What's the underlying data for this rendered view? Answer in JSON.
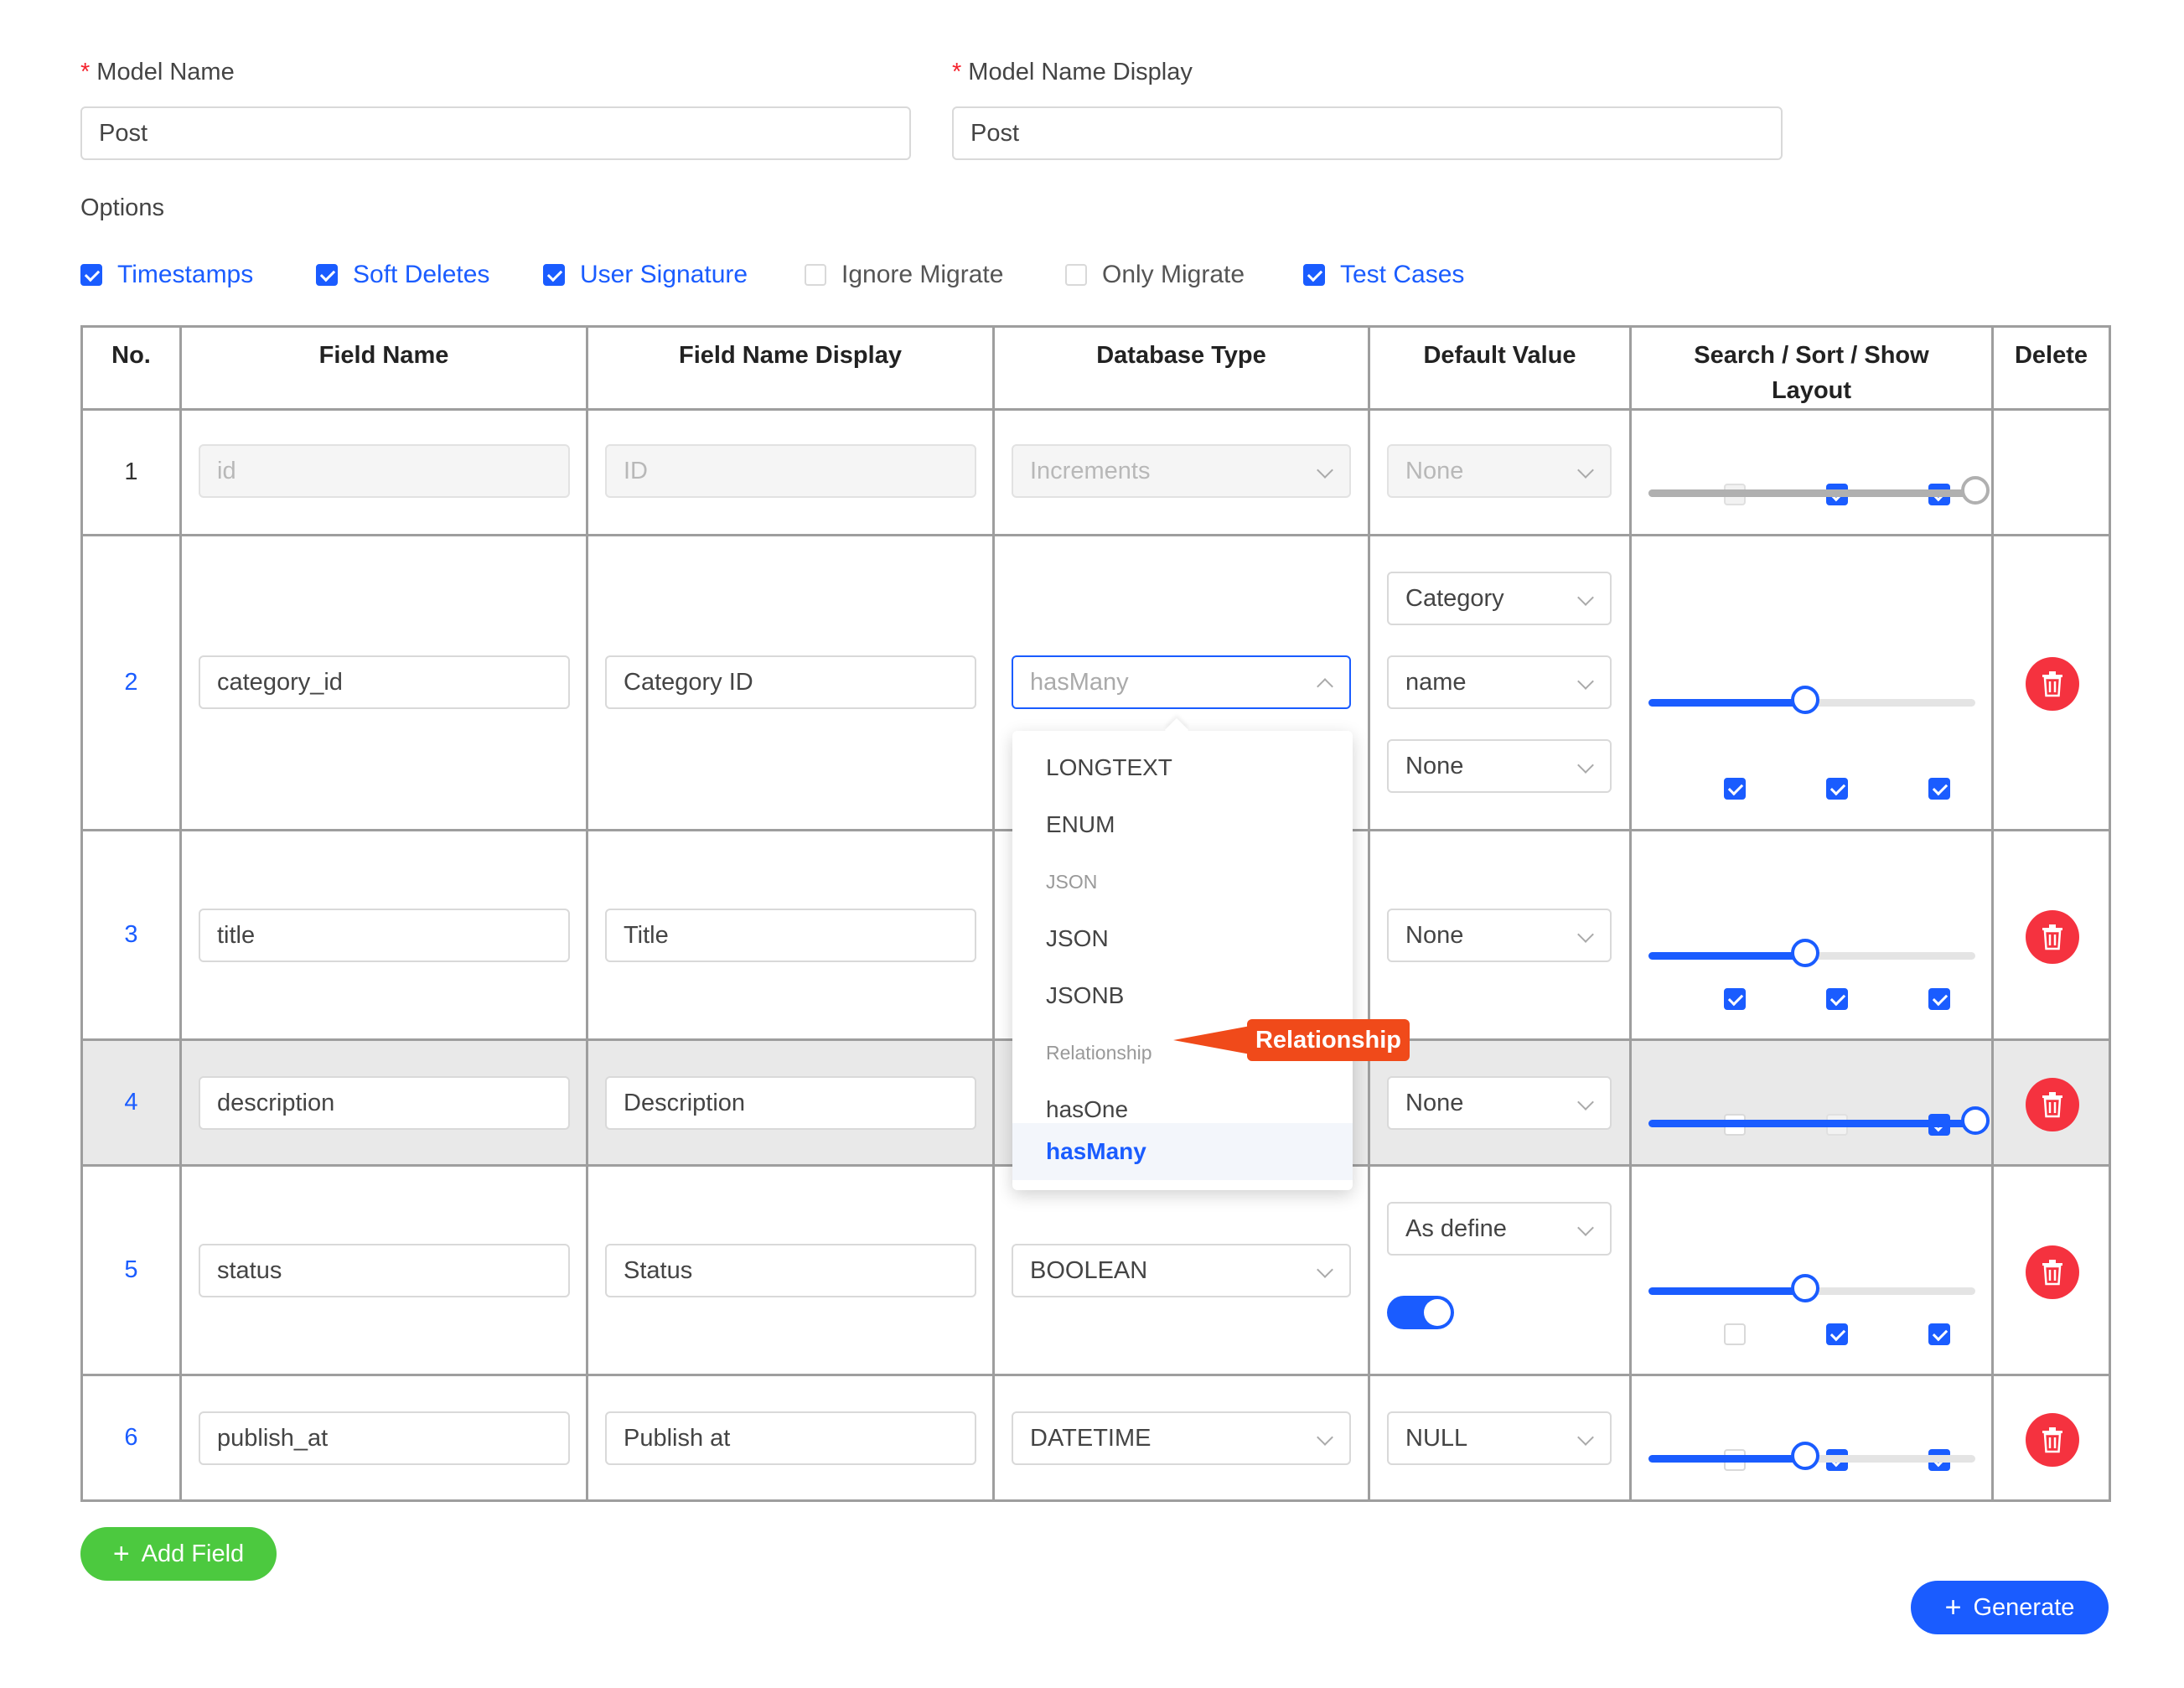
{
  "form": {
    "model_name": {
      "label": "Model Name",
      "value": "Post"
    },
    "model_name_display": {
      "label": "Model Name Display",
      "value": "Post"
    },
    "required_mark": "*"
  },
  "options": {
    "label": "Options",
    "items": [
      {
        "label": "Timestamps",
        "checked": true
      },
      {
        "label": "Soft Deletes",
        "checked": true
      },
      {
        "label": "User Signature",
        "checked": true
      },
      {
        "label": "Ignore Migrate",
        "checked": false
      },
      {
        "label": "Only Migrate",
        "checked": false
      },
      {
        "label": "Test Cases",
        "checked": true
      }
    ]
  },
  "table": {
    "headers": {
      "no": "No.",
      "field_name": "Field Name",
      "field_name_display": "Field Name Display",
      "database_type": "Database Type",
      "default_value": "Default Value",
      "search_sort_show": "Search / Sort / Show",
      "layout": "Layout",
      "delete": "Delete"
    },
    "rows": [
      {
        "no": "1",
        "field_name": "id",
        "display": "ID",
        "db_type": "Increments",
        "defaults": [
          "None"
        ],
        "search": false,
        "sort": true,
        "show": true,
        "layout": 1.0
      },
      {
        "no": "2",
        "field_name": "category_id",
        "display": "Category ID",
        "db_type": "hasMany",
        "defaults": [
          "Category",
          "name",
          "None"
        ],
        "search": true,
        "sort": true,
        "show": true,
        "layout": 0.48
      },
      {
        "no": "3",
        "field_name": "title",
        "display": "Title",
        "db_type": "",
        "defaults": [
          "None"
        ],
        "search": true,
        "sort": true,
        "show": true,
        "layout": 0.48
      },
      {
        "no": "4",
        "field_name": "description",
        "display": "Description",
        "db_type": "",
        "defaults": [
          "None"
        ],
        "search": false,
        "sort": false,
        "show": true,
        "layout": 1.0
      },
      {
        "no": "5",
        "field_name": "status",
        "display": "Status",
        "db_type": "BOOLEAN",
        "defaults": [
          "As define"
        ],
        "toggle_on": true,
        "search": false,
        "sort": true,
        "show": true,
        "layout": 0.48
      },
      {
        "no": "6",
        "field_name": "publish_at",
        "display": "Publish at",
        "db_type": "DATETIME",
        "defaults": [
          "NULL"
        ],
        "search": false,
        "sort": true,
        "show": true,
        "layout": 0.48
      }
    ]
  },
  "dropdown": {
    "items": [
      {
        "label": "LONGTEXT",
        "type": "option"
      },
      {
        "label": "ENUM",
        "type": "option"
      },
      {
        "label": "JSON",
        "type": "group"
      },
      {
        "label": "JSON",
        "type": "option"
      },
      {
        "label": "JSONB",
        "type": "option"
      },
      {
        "label": "Relationship",
        "type": "group"
      },
      {
        "label": "hasOne",
        "type": "option"
      },
      {
        "label": "hasMany",
        "type": "selected"
      }
    ],
    "callout": "Relationship"
  },
  "buttons": {
    "add_field": "Add Field",
    "generate": "Generate",
    "plus": "+"
  },
  "colors": {
    "primary": "#1a5cff",
    "success": "#4cc93f",
    "danger": "#f5323f",
    "callout": "#f04a1a"
  }
}
